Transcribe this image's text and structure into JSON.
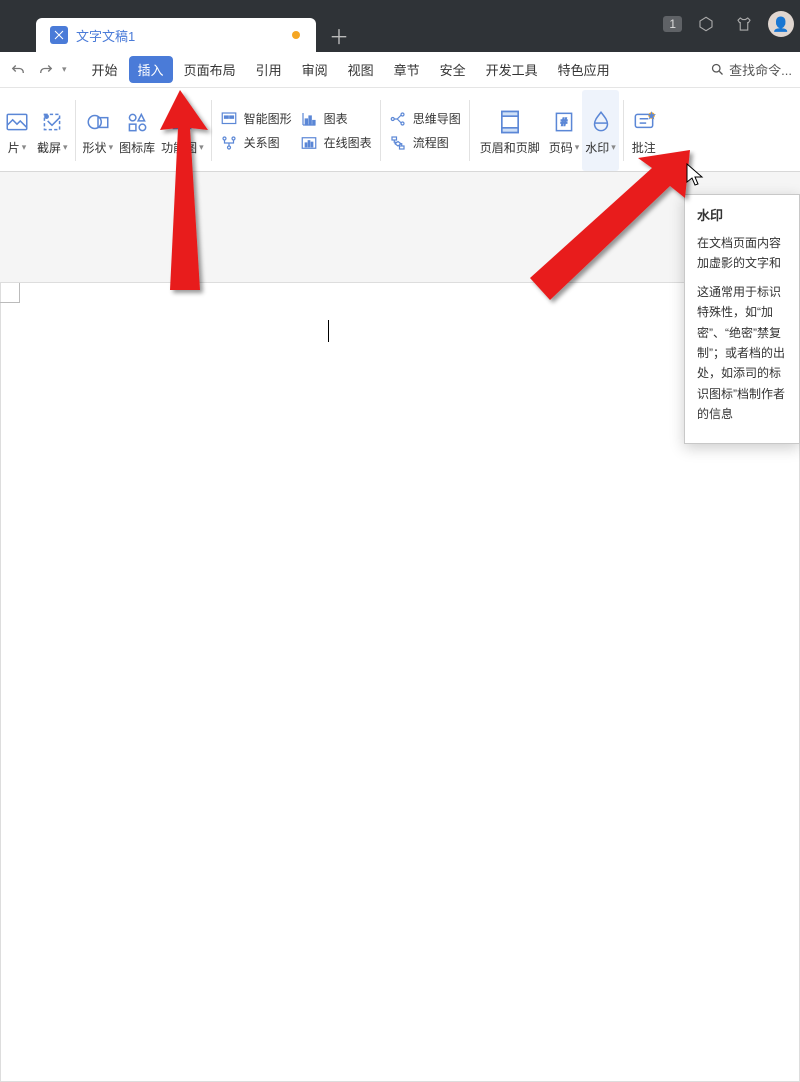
{
  "titlebar": {
    "tab_title": "文字文稿1",
    "badge": "1"
  },
  "menubar": {
    "tabs": [
      "开始",
      "插入",
      "页面布局",
      "引用",
      "审阅",
      "视图",
      "章节",
      "安全",
      "开发工具",
      "特色应用"
    ],
    "active_index": 1,
    "search_label": "查找命令..."
  },
  "ribbon": {
    "btn_pic": "片",
    "btn_screenshot": "截屏",
    "btn_shape": "形状",
    "btn_iconlib": "图标库",
    "btn_funcpic": "功能图",
    "smartart": "智能图形",
    "chart": "图表",
    "relation": "关系图",
    "onlinechart": "在线图表",
    "mindmap": "思维导图",
    "flowchart": "流程图",
    "headerfooter": "页眉和页脚",
    "pagenum": "页码",
    "watermark": "水印",
    "comment": "批注"
  },
  "tooltip": {
    "title": "水印",
    "p1": "在文档页面内容加虚影的文字和",
    "p2": "这通常用于标识特殊性，如“加密”、“绝密”禁复制”；或者档的出处，如添司的标识图标”档制作者的信息"
  }
}
